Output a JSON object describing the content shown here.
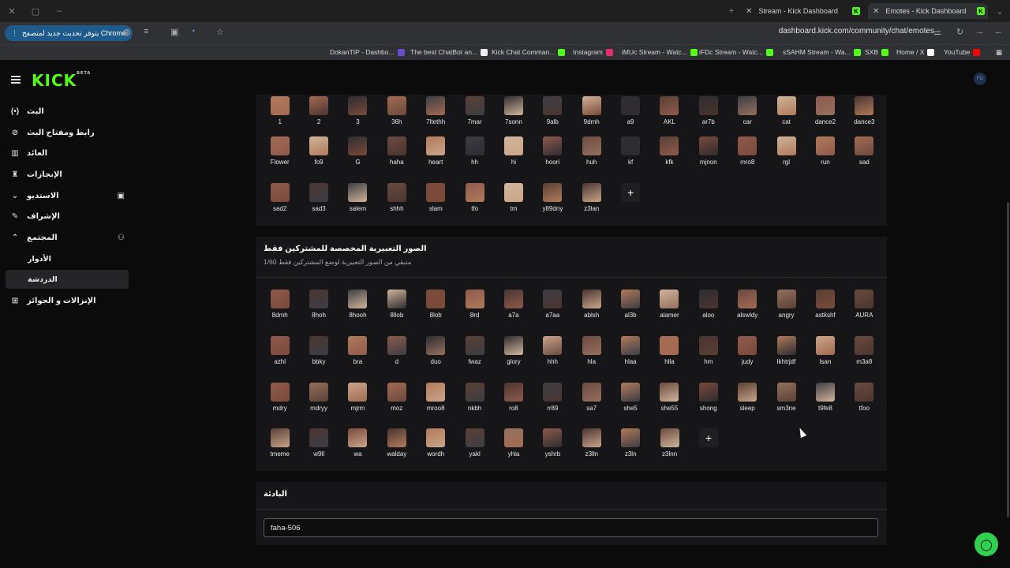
{
  "browser": {
    "tabs": [
      {
        "title": "Stream - Kick Dashboard",
        "active": false
      },
      {
        "title": "Emotes - Kick Dashboard",
        "active": true
      }
    ],
    "update_label": "يتوفر تحديث جديد لمتصفح Chrome",
    "url": "dashboard.kick.com/community/chat/emotes",
    "bookmarks": [
      {
        "label": "DokanTIP - Dashbo...",
        "color": "#6c4ccf"
      },
      {
        "label": "The best ChatBot an...",
        "color": "#f0f0f0"
      },
      {
        "label": "Kick Chat Comman...",
        "color": "#53fc18"
      },
      {
        "label": "Instagram",
        "color": "#e1306c"
      },
      {
        "label": "iMUc Stream - Watc...",
        "color": "#53fc18"
      },
      {
        "label": "iFDc Stream - Watc...",
        "color": "#53fc18"
      },
      {
        "label": "sSAHM Stream - Wa...",
        "color": "#53fc18"
      },
      {
        "label": "SXB",
        "color": "#53fc18"
      },
      {
        "label": "Home / X",
        "color": "#ffffff"
      },
      {
        "label": "YouTube",
        "color": "#ff0000"
      }
    ]
  },
  "header": {
    "logo": "KICK",
    "logo_badge": "BETA",
    "avatar_initials": "FD"
  },
  "sidebar": {
    "items": [
      {
        "label": "البث",
        "icon": "(•)"
      },
      {
        "label": "رابط ومفتاح البث",
        "icon": "🔗"
      },
      {
        "label": "العائد",
        "icon": "▥"
      },
      {
        "label": "الإنجازات",
        "icon": "🏆"
      },
      {
        "label": "الاستديو",
        "icon": "⌄"
      },
      {
        "label": "الإشراف",
        "icon": "🔧"
      },
      {
        "label": "المجتمع",
        "icon": "⌃"
      },
      {
        "label": "الأدوار",
        "icon": ""
      },
      {
        "label": "الدردشة",
        "icon": ""
      },
      {
        "label": "الإنزالات و الجوائز",
        "icon": "🎁"
      }
    ]
  },
  "main": {
    "top_emotes_row1": [
      "1",
      "2",
      "3",
      "36h",
      "7ltethh",
      "7mar",
      "7sonn",
      "9alb",
      "9dmh",
      "a9",
      "AKL",
      "ar7b",
      "car",
      "cat",
      "dance2",
      "dance3"
    ],
    "top_emotes_row2": [
      "Flower",
      "fo9",
      "G",
      "haha",
      "heart",
      "hh",
      "hi",
      "hoori",
      "huh",
      "kf",
      "kfk",
      "mjnon",
      "mro8",
      "rgl",
      "run",
      "sad"
    ],
    "top_emotes_row3": [
      "sad2",
      "sad3",
      "salem",
      "shhh",
      "slam",
      "tfo",
      "tm",
      "y89dny",
      "z3lan"
    ],
    "subs_section": {
      "title": "الصور التعبيرية المخصصة للمشتركين فقط",
      "subtitle": "متبقي من الصور التعبيرية لوضع المشتركين فقط 1/60"
    },
    "sub_emotes_row1": [
      "8dmh",
      "8hoh",
      "8hooh",
      "8llob",
      "8lob",
      "8rd",
      "a7a",
      "a7aa",
      "ablsh",
      "al3b",
      "alamer",
      "aloo",
      "alswldy",
      "angry",
      "astkshf",
      "AURA"
    ],
    "sub_emotes_row2": [
      "azhl",
      "bbky",
      "bra",
      "d",
      "duo",
      "fwaz",
      "glory",
      "hhh",
      "hla",
      "hlaa",
      "hlla",
      "hm",
      "judy",
      "lkhtrjdf",
      "lsan",
      "m3a8"
    ],
    "sub_emotes_row3": [
      "mdry",
      "mdryy",
      "mjrm",
      "moz",
      "mroo8",
      "nkbh",
      "ro8",
      "rr89",
      "sa7",
      "she5",
      "she55",
      "shong",
      "sleep",
      "sm3ne",
      "t9fe8",
      "tfoo"
    ],
    "sub_emotes_row4": [
      "tmeme",
      "w9ll",
      "wa",
      "walday",
      "wordh",
      "yakl",
      "yhla",
      "yshrb",
      "z3lln",
      "z3ln",
      "z3lnn"
    ],
    "prefix_section": {
      "title": "البادئة",
      "value": "faha-506"
    }
  }
}
